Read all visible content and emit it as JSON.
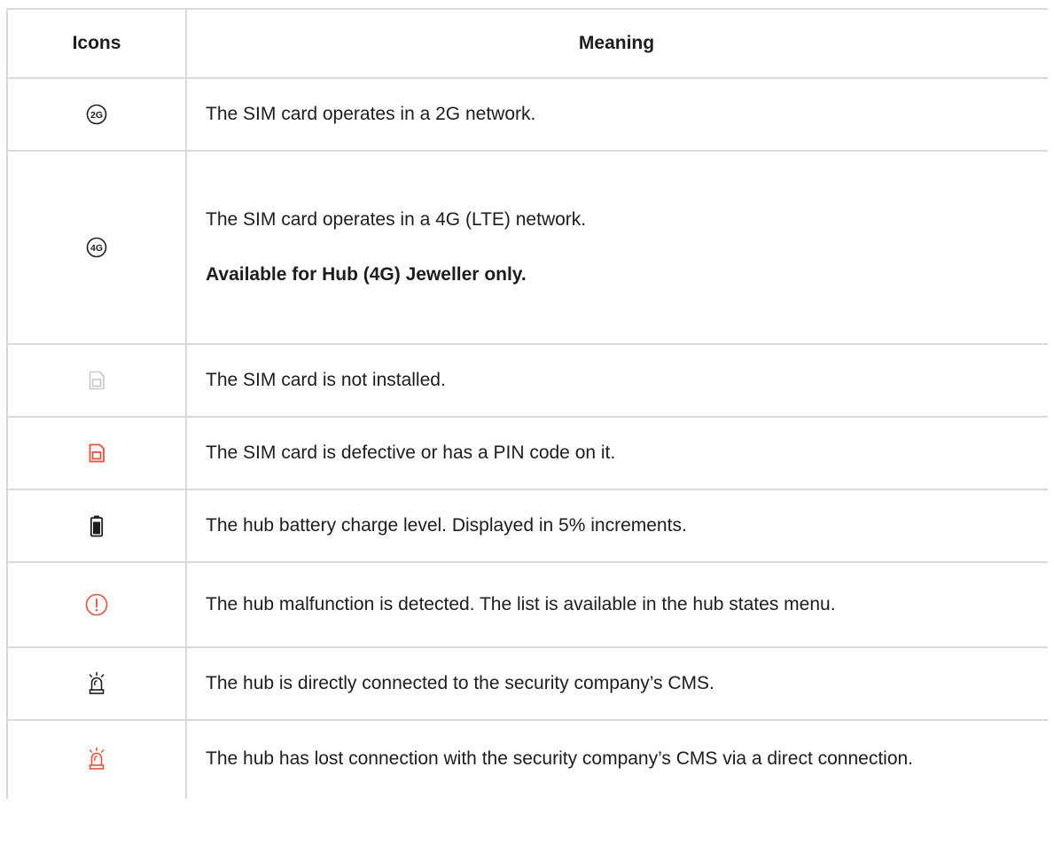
{
  "table": {
    "headers": {
      "icons": "Icons",
      "meaning": "Meaning"
    },
    "rows": [
      {
        "icon": "2g-network-icon",
        "icon_text": "2G",
        "meaning": "The SIM card operates in a 2G network."
      },
      {
        "icon": "4g-network-icon",
        "icon_text": "4G",
        "meaning": "The SIM card operates in a 4G (LTE) network.",
        "note": "Available for Hub (4G) Jeweller only."
      },
      {
        "icon": "sim-card-icon",
        "meaning": "The SIM card is not installed."
      },
      {
        "icon": "sim-card-error-icon",
        "meaning": "The SIM card is defective or has a PIN code on it."
      },
      {
        "icon": "battery-icon",
        "meaning": "The hub battery charge level. Displayed in 5% increments."
      },
      {
        "icon": "malfunction-icon",
        "meaning": "The hub malfunction is detected. The list is available in the hub states menu."
      },
      {
        "icon": "siren-icon",
        "meaning": "The hub is directly connected to the security company’s CMS."
      },
      {
        "icon": "siren-error-icon",
        "meaning": "The hub has lost connection with the security company’s CMS via a direct connection."
      }
    ]
  },
  "colors": {
    "text": "#1d1d1d",
    "grid": "#d9d9d9",
    "icon_gray": "#c8c8c8",
    "icon_red": "#e8503a",
    "icon_dark": "#1d1d1d"
  }
}
